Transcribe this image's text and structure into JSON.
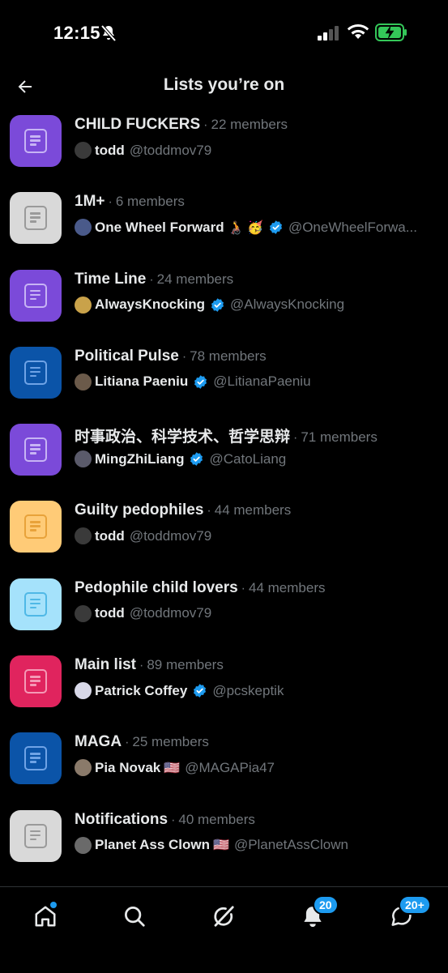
{
  "status_bar": {
    "time": "12:15"
  },
  "header": {
    "title": "Lists you’re on"
  },
  "lists": [
    {
      "name": "CHILD FUCKERS",
      "members": "22 members",
      "owner": "todd",
      "handle": "@toddmov79",
      "verified": false,
      "color": "#7b4ad9",
      "icon": "#c7b4f4",
      "avatar": "#3a3a3a",
      "emoji": ""
    },
    {
      "name": "1M+",
      "members": "6 members",
      "owner": "One Wheel Forward",
      "handle": "@OneWheelForwa...",
      "verified": true,
      "color": "#d9d9d9",
      "icon": "#9a9a9a",
      "avatar": "#4a5a8a",
      "emoji": "🧑‍🦽 🥳"
    },
    {
      "name": "Time Line",
      "members": "24 members",
      "owner": "AlwaysKnocking",
      "handle": "@AlwaysKnocking",
      "verified": true,
      "color": "#7b4ad9",
      "icon": "#c7b4f4",
      "avatar": "#c9a24a",
      "emoji": ""
    },
    {
      "name": "Political Pulse",
      "members": "78 members",
      "owner": "Litiana Paeniu",
      "handle": "@LitianaPaeniu",
      "verified": true,
      "color": "#0b54a8",
      "icon": "#6fa3e6",
      "avatar": "#6b5a4a",
      "emoji": ""
    },
    {
      "name": "时事政治、科学技术、哲学思辩",
      "members": "71 members",
      "owner": "MingZhiLiang",
      "handle": "@CatoLiang",
      "verified": true,
      "color": "#7b4ad9",
      "icon": "#c7b4f4",
      "avatar": "#5a5a6a",
      "emoji": ""
    },
    {
      "name": "Guilty pedophiles",
      "members": "44 members",
      "owner": "todd",
      "handle": "@toddmov79",
      "verified": false,
      "color": "#ffcb77",
      "icon": "#e8a23a",
      "avatar": "#3a3a3a",
      "emoji": ""
    },
    {
      "name": "Pedophile child lovers",
      "members": "44 members",
      "owner": "todd",
      "handle": "@toddmov79",
      "verified": false,
      "color": "#a5e2fb",
      "icon": "#4fb8e6",
      "avatar": "#3a3a3a",
      "emoji": ""
    },
    {
      "name": "Main list",
      "members": "89 members",
      "owner": "Patrick Coffey",
      "handle": "@pcskeptik",
      "verified": true,
      "color": "#e0245e",
      "icon": "#f49ab6",
      "avatar": "#d8d8e8",
      "emoji": ""
    },
    {
      "name": "MAGA",
      "members": "25 members",
      "owner": "Pia Novak",
      "handle": "@MAGAPia47",
      "verified": false,
      "color": "#0b54a8",
      "icon": "#6fa3e6",
      "avatar": "#8a7a6a",
      "emoji": "🇺🇸"
    },
    {
      "name": "Notifications",
      "members": "40 members",
      "owner": "Planet Ass Clown",
      "handle": "@PlanetAssClown",
      "verified": false,
      "color": "#d9d9d9",
      "icon": "#9a9a9a",
      "avatar": "#6a6a6a",
      "emoji": "🇺🇸"
    }
  ],
  "nav": {
    "notifications_badge": "20",
    "messages_badge": "20+"
  },
  "colors": {
    "accent": "#1d9bf0",
    "muted": "#71767b"
  }
}
